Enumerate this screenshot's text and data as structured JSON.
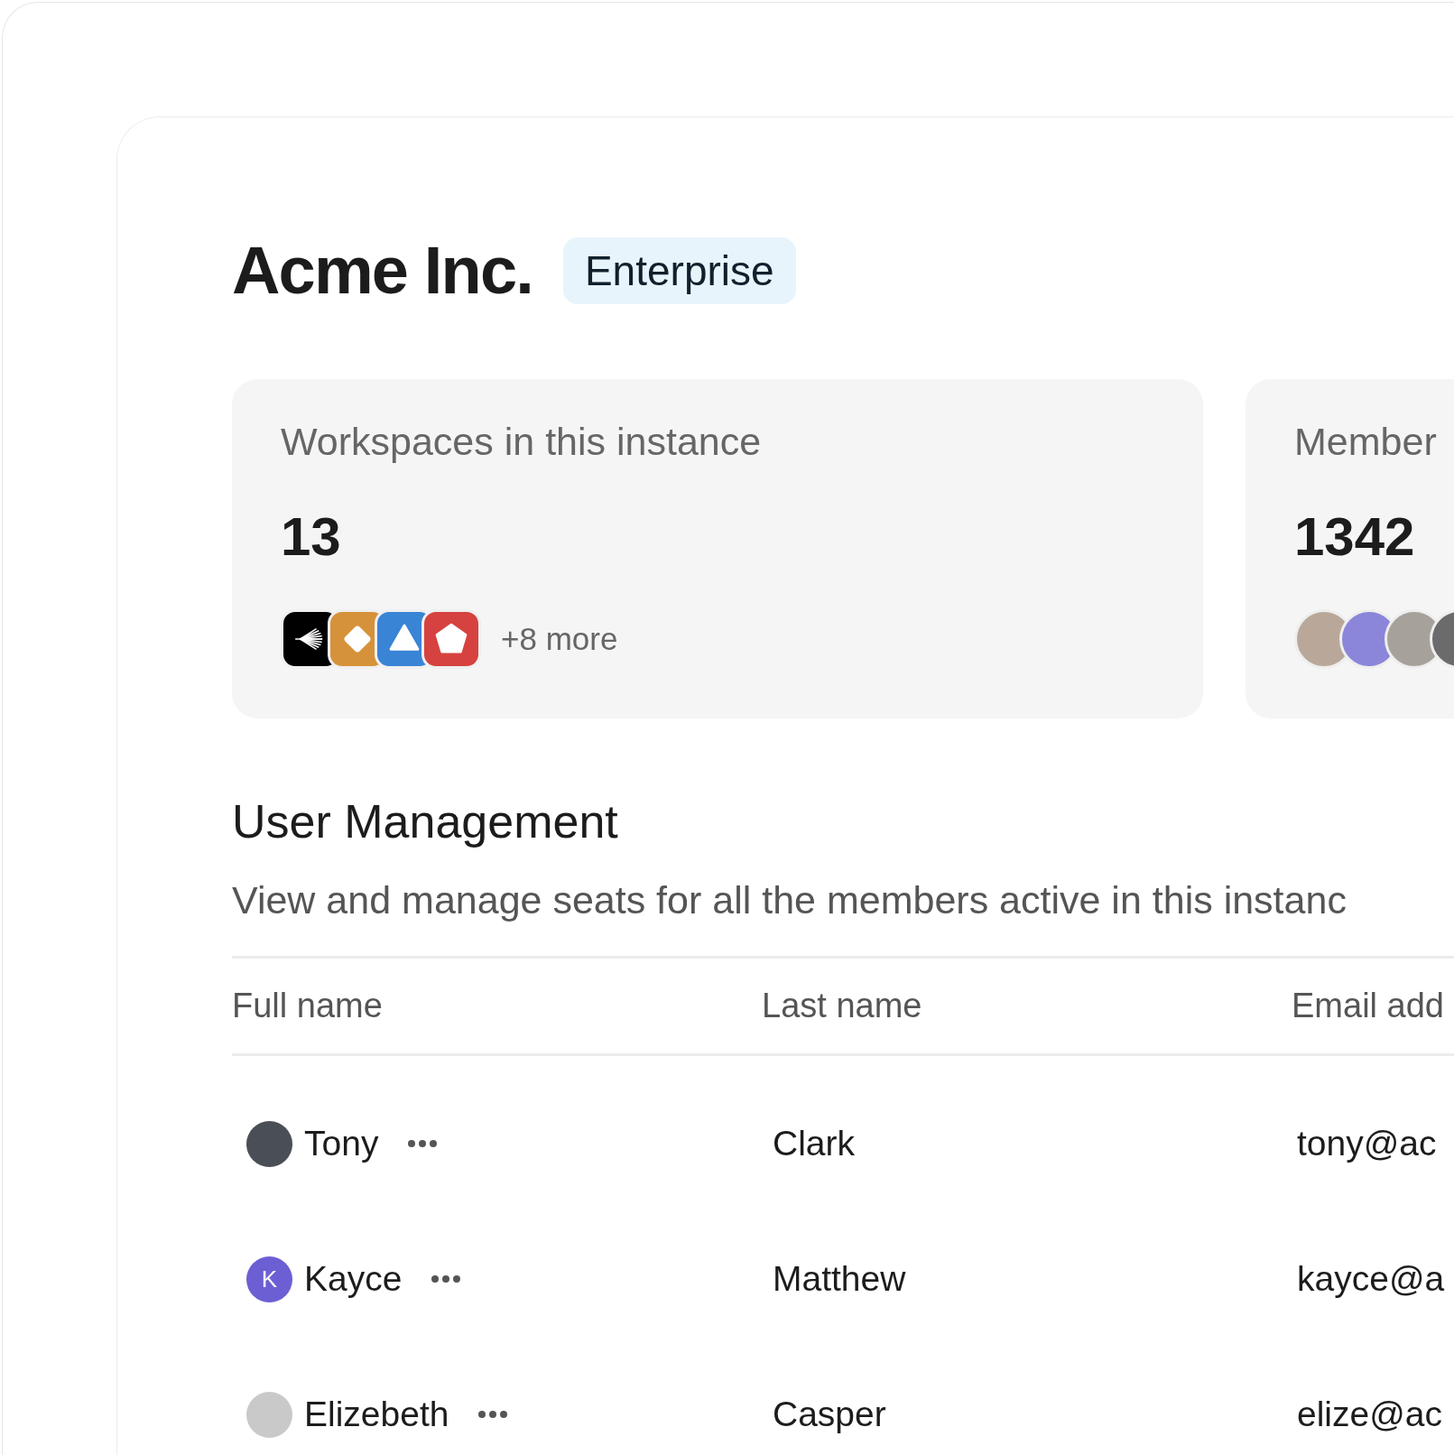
{
  "title": "Acme Inc.",
  "plan_badge": "Enterprise",
  "stat_cards": [
    {
      "label": "Workspaces in this instance",
      "value": "13",
      "kind": "workspaces",
      "more": "+8 more",
      "items": [
        {
          "kind": "burst",
          "color": "#000000"
        },
        {
          "kind": "diamond",
          "color": "#d6923a"
        },
        {
          "kind": "triangle",
          "color": "#3a84d6"
        },
        {
          "kind": "pentagon",
          "color": "#d6423f"
        }
      ]
    },
    {
      "label": "Member",
      "value": "1342",
      "kind": "members",
      "items": [
        {
          "color": "#b9a89a"
        },
        {
          "color": "#8b86d9"
        },
        {
          "color": "#a7a19c"
        },
        {
          "color": "#6b6b6b"
        }
      ]
    }
  ],
  "section": {
    "title": "User Management",
    "description": "View and manage seats for all the members active in this instanc"
  },
  "table": {
    "columns": [
      "Full name",
      "Last name",
      "Email add"
    ],
    "rows": [
      {
        "name": "Tony",
        "avatar": {
          "kind": "photo",
          "color": "#4a4f57"
        },
        "last_name": "Clark",
        "email": "tony@ac"
      },
      {
        "name": "Kayce",
        "avatar": {
          "kind": "initial",
          "initial": "K",
          "color": "#6c5fd3"
        },
        "last_name": "Matthew",
        "email": "kayce@a"
      },
      {
        "name": "Elizebeth",
        "avatar": {
          "kind": "photo",
          "color": "#c9c9c9"
        },
        "last_name": "Casper",
        "email": "elize@ac"
      }
    ]
  }
}
